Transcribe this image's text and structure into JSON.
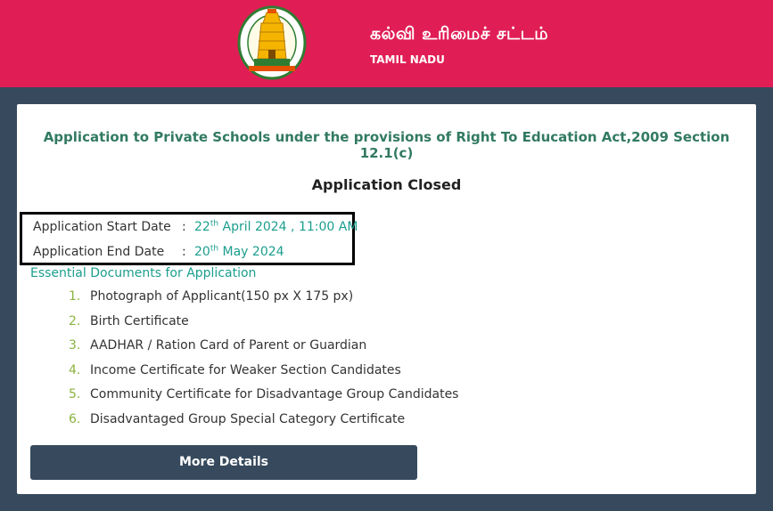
{
  "header": {
    "title_tamil": "கல்வி உரிமைச் சட்டம்",
    "state": "TAMIL NADU",
    "background": "#e01e55"
  },
  "card": {
    "heading": "Application to Private Schools under the provisions of Right To Education Act,2009 Section 12.1(c)",
    "status": "Application Closed",
    "start_date": {
      "label": "Application Start Date",
      "separator": ":",
      "day": "22",
      "day_suffix": "th",
      "rest": " April 2024 , 11:00 AM"
    },
    "end_date": {
      "label": "Application End Date",
      "separator": ":",
      "day": "20",
      "day_suffix": "th",
      "rest": " May 2024"
    },
    "docs_heading": "Essential Documents for Application",
    "documents": [
      {
        "num": "1.",
        "text": "Photograph of Applicant(150 px X 175 px)"
      },
      {
        "num": "2.",
        "text": "Birth Certificate"
      },
      {
        "num": "3.",
        "text": "AADHAR / Ration Card of Parent or Guardian"
      },
      {
        "num": "4.",
        "text": "Income Certificate for Weaker Section Candidates"
      },
      {
        "num": "5.",
        "text": "Community Certificate for Disadvantage Group Candidates"
      },
      {
        "num": "6.",
        "text": "Disadvantaged Group Special Category Certificate"
      }
    ],
    "more_button": "More Details"
  },
  "colors": {
    "accent_green": "#1b9e8e",
    "heading_green": "#327a62",
    "list_number": "#8ab33f",
    "page_bg": "#374a5d"
  },
  "icons": {
    "emblem": "tamil-nadu-emblem-icon"
  }
}
